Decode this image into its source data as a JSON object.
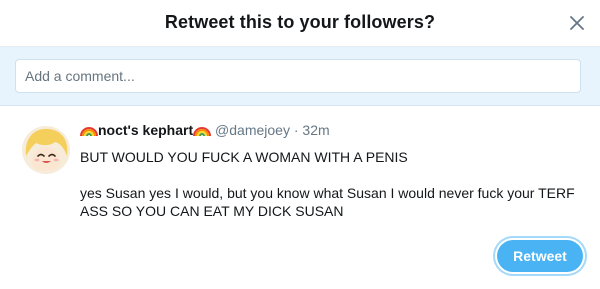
{
  "modal": {
    "title": "Retweet this to your followers?",
    "close_icon": "close-icon"
  },
  "comment": {
    "placeholder": "Add a comment..."
  },
  "tweet": {
    "display_name": "noct's kephart",
    "name_decoration_icon": "rainbow-icon",
    "handle": "@damejoey",
    "separator": "·",
    "time": "32m",
    "text_line1": "BUT WOULD YOU FUCK A WOMAN WITH A PENIS",
    "text_line2": "yes Susan yes I would, but you know what Susan I would never fuck your TERF ASS SO YOU CAN EAT MY DICK SUSAN"
  },
  "actions": {
    "retweet_label": "Retweet"
  },
  "colors": {
    "accent": "#4ab3f4",
    "compose_bg": "#e8f4fd",
    "text_primary": "#14171a",
    "text_secondary": "#657786"
  }
}
